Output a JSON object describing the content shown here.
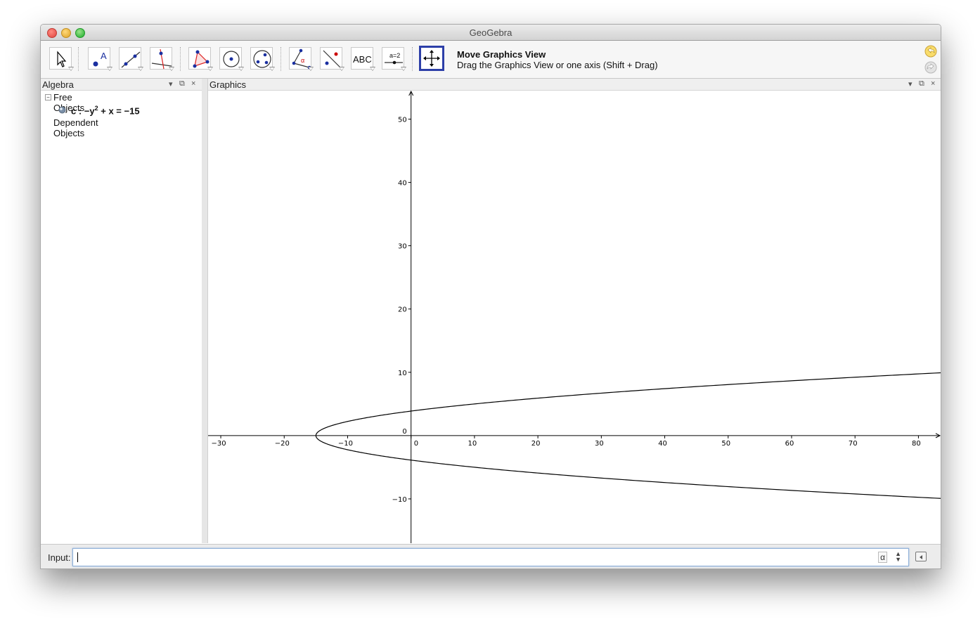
{
  "window": {
    "title": "GeoGebra"
  },
  "toolbar": {
    "tools": [
      {
        "name": "move-tool"
      },
      {
        "name": "point-tool"
      },
      {
        "name": "line-tool"
      },
      {
        "name": "perpendicular-line-tool"
      },
      {
        "name": "polygon-tool"
      },
      {
        "name": "circle-tool"
      },
      {
        "name": "ellipse-tool"
      },
      {
        "name": "angle-tool"
      },
      {
        "name": "reflect-tool"
      },
      {
        "name": "text-tool",
        "label": "ABC"
      },
      {
        "name": "slider-tool",
        "label": "a=2"
      },
      {
        "name": "move-graphics-view-tool"
      }
    ],
    "help_title": "Move Graphics View",
    "help_description": "Drag the Graphics View or one axis (Shift + Drag)"
  },
  "algebra": {
    "title": "Algebra",
    "free_objects_label": "Free Objects",
    "object_name": "c :",
    "object_equation_prefix": "−y",
    "object_exponent": "2",
    "object_equation_suffix": "+ x = −15",
    "dependent_objects_label": "Dependent Objects"
  },
  "graphics": {
    "title": "Graphics"
  },
  "input": {
    "label": "Input:",
    "value": "",
    "alpha_button": "α"
  },
  "chart_data": {
    "type": "line",
    "title": "",
    "xlabel": "",
    "ylabel": "",
    "xlim": [
      -32,
      83.5
    ],
    "ylim": [
      -17,
      54.5
    ],
    "x_ticks": [
      -30,
      -20,
      -10,
      0,
      10,
      20,
      30,
      40,
      50,
      60,
      70,
      80
    ],
    "y_ticks": [
      -10,
      0,
      10,
      20,
      30,
      40,
      50
    ],
    "grid": false,
    "curve": {
      "equation": "-y^2 + x = -15",
      "vertex": [
        -15,
        0
      ],
      "points_upper": [
        [
          -15,
          0
        ],
        [
          0,
          3.87
        ],
        [
          20,
          5.92
        ],
        [
          50,
          8.06
        ],
        [
          83.5,
          9.9
        ]
      ],
      "points_lower": [
        [
          -15,
          0
        ],
        [
          0,
          -3.87
        ],
        [
          20,
          -5.92
        ],
        [
          50,
          -8.06
        ],
        [
          83.5,
          -9.9
        ]
      ]
    }
  }
}
